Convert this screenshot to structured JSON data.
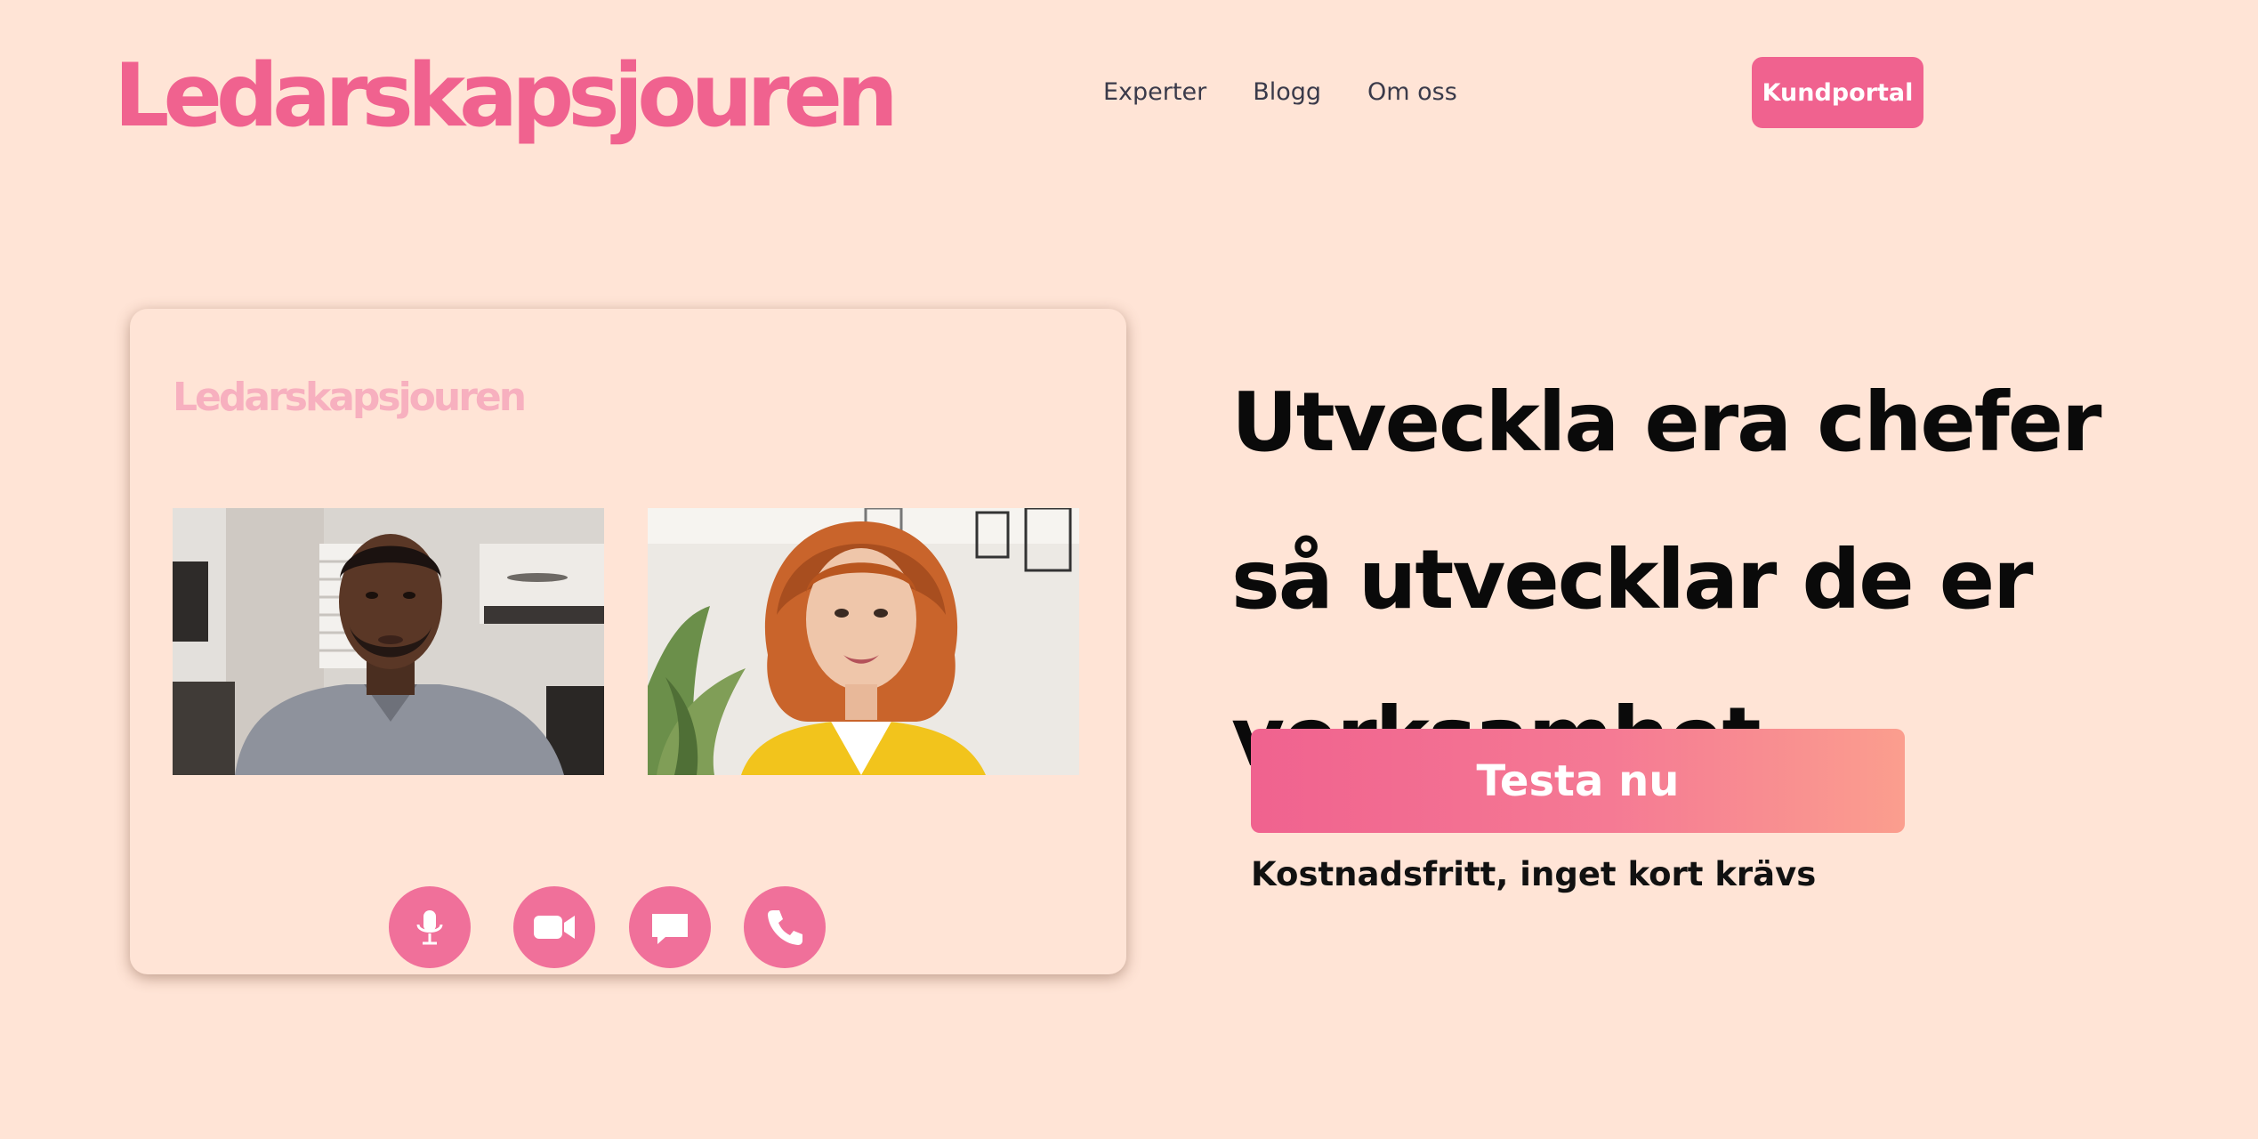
{
  "header": {
    "logo": "Ledarskapsjouren",
    "nav": [
      "Experter",
      "Blogg",
      "Om oss"
    ],
    "portal_button": "Kundportal"
  },
  "call_card": {
    "logo": "Ledarskapsjouren",
    "participants": [
      {
        "image": "man-video-call-photo"
      },
      {
        "image": "woman-video-call-photo"
      }
    ],
    "controls": [
      {
        "icon": "microphone-icon"
      },
      {
        "icon": "video-camera-icon"
      },
      {
        "icon": "chat-icon"
      },
      {
        "icon": "phone-icon"
      }
    ]
  },
  "hero": {
    "headline_lines": [
      "Utveckla era chefer",
      "så utvecklar de er",
      "verksamhet"
    ],
    "cta_label": "Testa nu",
    "subline": "Kostnadsfritt, inget kort krävs"
  },
  "colors": {
    "background": "#ffe4d6",
    "brand_pink": "#f0628f",
    "card_logo_pink": "#f7b0bf",
    "cta_gradient_start": "#f0628f",
    "cta_gradient_end": "#fb9e8e",
    "headline": "#0a0a0a"
  }
}
